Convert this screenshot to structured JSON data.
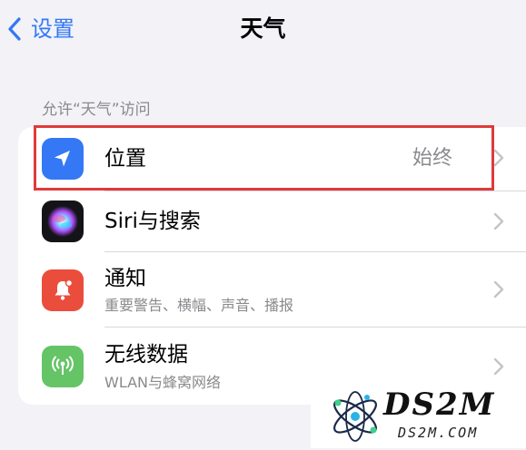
{
  "nav": {
    "back_label": "设置",
    "title": "天气"
  },
  "section": {
    "header": "允许“天气”访问"
  },
  "rows": [
    {
      "title": "位置",
      "value": "始终",
      "icon": "location-arrow-icon",
      "icon_color": "#3478f6"
    },
    {
      "title": "Siri与搜索",
      "icon": "siri-icon"
    },
    {
      "title": "通知",
      "subtitle": "重要警告、横幅、声音、播报",
      "icon": "bell-icon",
      "icon_color": "#eb4d3d"
    },
    {
      "title": "无线数据",
      "subtitle": "WLAN与蜂窝网络",
      "icon": "antenna-icon",
      "icon_color": "#65c466"
    }
  ],
  "watermark": {
    "name": "DS2M",
    "url": "DS2M.COM"
  },
  "colors": {
    "accent": "#3478f6",
    "highlight": "#e03a3a",
    "background": "#f2f2f7",
    "secondary_text": "#8a8a8e"
  }
}
